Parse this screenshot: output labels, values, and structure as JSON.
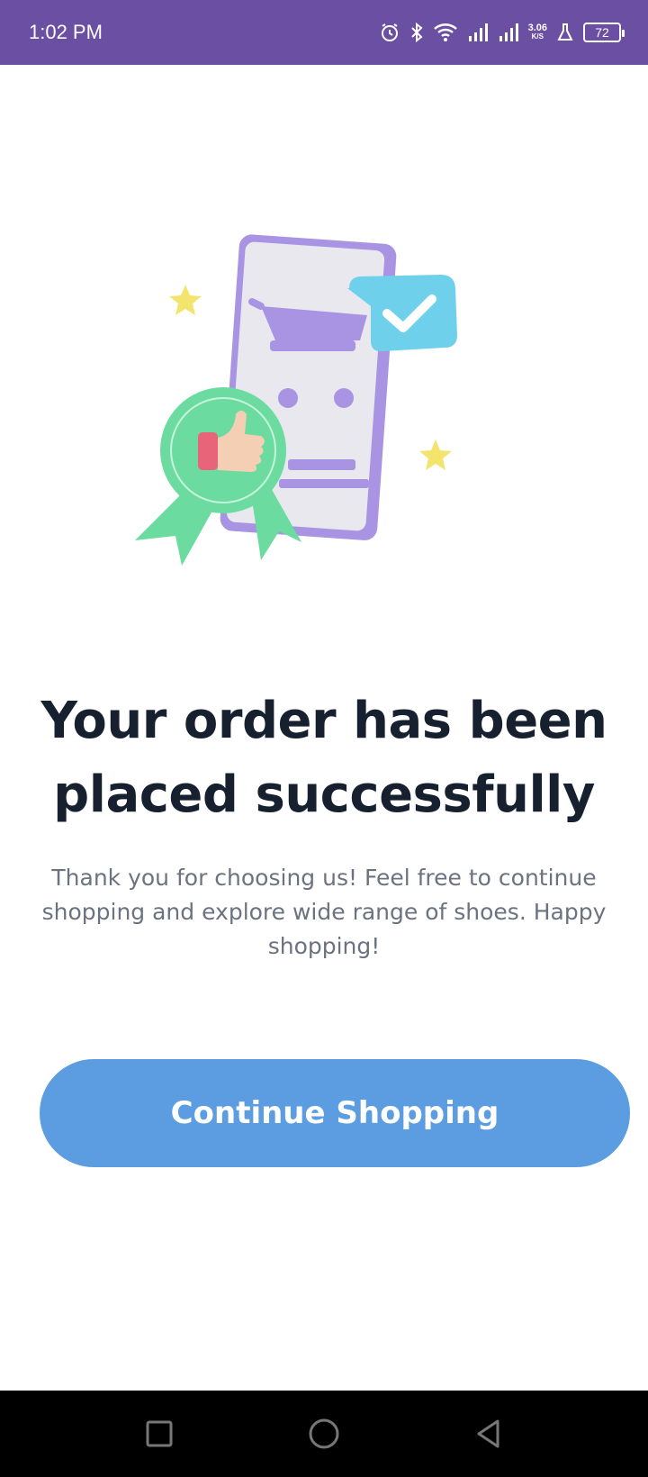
{
  "status_bar": {
    "time": "1:02 PM",
    "net_speed_value": "3.06",
    "net_speed_unit": "K/S",
    "battery": "72",
    "icons": [
      "alarm-icon",
      "bluetooth-icon",
      "wifi-icon",
      "signal-icon",
      "signal-icon",
      "flask-icon",
      "battery-icon"
    ]
  },
  "illustration": {
    "name": "order-success-illustration",
    "colors": {
      "phone": "#a993e3",
      "bubble": "#6fd0ec",
      "badge": "#6bdb9f",
      "star": "#f2e46d"
    }
  },
  "content": {
    "headline_line1": "Your order has been",
    "headline_line2": "placed successfully",
    "message": "Thank you for choosing us! Feel free to continue shopping and explore wide range of shoes. Happy shopping!",
    "cta_label": "Continue Shopping"
  },
  "nav_bar": {
    "buttons": [
      "recents-icon",
      "home-icon",
      "back-icon"
    ]
  },
  "colors": {
    "status_bar": "#6a4fa3",
    "primary_button": "#5b9de0",
    "headline": "#17202e",
    "body_text": "#6b7380"
  }
}
